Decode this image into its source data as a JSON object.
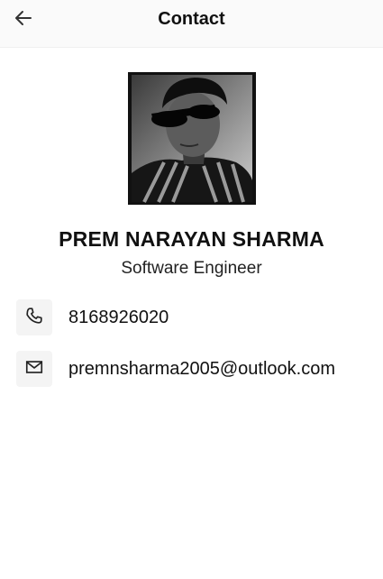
{
  "header": {
    "title": "Contact",
    "back_icon": "arrow-left-icon"
  },
  "profile": {
    "name": "PREM NARAYAN SHARMA",
    "role": "Software Engineer",
    "photo": "profile-photo"
  },
  "contacts": [
    {
      "icon": "phone-icon",
      "value": "8168926020"
    },
    {
      "icon": "mail-icon",
      "value": "premnsharma2005@outlook.com"
    }
  ],
  "colors": {
    "background": "#ffffff",
    "header_background": "#fafafa",
    "icon_tile": "#f4f4f4",
    "text": "#111111"
  }
}
